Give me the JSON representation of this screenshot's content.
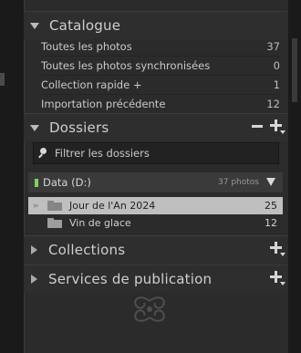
{
  "catalogue": {
    "title": "Catalogue",
    "items": [
      {
        "label": "Toutes les photos",
        "count": "37"
      },
      {
        "label": "Toutes les photos synchronisées",
        "count": "0"
      },
      {
        "label": "Collection rapide +",
        "count": "1"
      },
      {
        "label": "Importation précédente",
        "count": "12"
      }
    ]
  },
  "folders": {
    "title": "Dossiers",
    "filter_placeholder": "Filtrer les dossiers",
    "volume": {
      "name": "Data (D:)",
      "size": "37 photos",
      "status_color": "#7cd45f"
    },
    "items": [
      {
        "label": "Jour de l'An 2024",
        "count": "25",
        "selected": true
      },
      {
        "label": "Vin de glace",
        "count": "12",
        "selected": false
      }
    ]
  },
  "collections": {
    "title": "Collections"
  },
  "publish": {
    "title": "Services de publication"
  }
}
